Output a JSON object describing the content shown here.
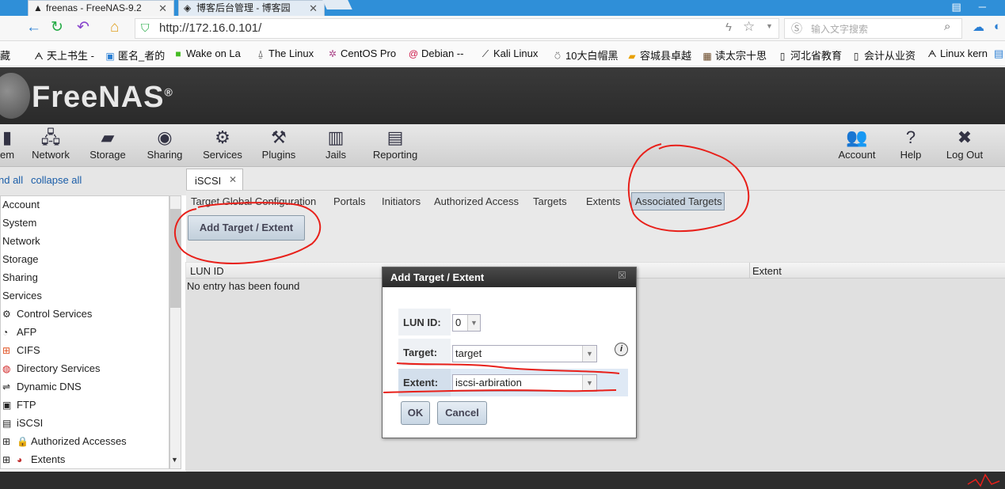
{
  "browser": {
    "tabs": [
      {
        "label": "freenas - FreeNAS-9.2",
        "icon": "freenas-icon"
      },
      {
        "label": "博客后台管理 - 博客园",
        "icon": "page-icon"
      }
    ],
    "url": "http://172.16.0.101/",
    "search_placeholder": "输入文字搜索",
    "bookmarks": [
      {
        "label": "藏",
        "icon": "folder-icon"
      },
      {
        "label": "天上书生 -",
        "icon": "link-icon"
      },
      {
        "label": "匿名_者的",
        "icon": "link-icon"
      },
      {
        "label": "Wake on La",
        "icon": "link-icon"
      },
      {
        "label": "The Linux",
        "icon": "link-icon"
      },
      {
        "label": "CentOS Pro",
        "icon": "link-icon"
      },
      {
        "label": "Debian --",
        "icon": "link-icon"
      },
      {
        "label": "Kali Linux",
        "icon": "link-icon"
      },
      {
        "label": "10大白帽黑",
        "icon": "link-icon"
      },
      {
        "label": "容城县卓越",
        "icon": "link-icon"
      },
      {
        "label": "读太宗十思",
        "icon": "link-icon"
      },
      {
        "label": "河北省教育",
        "icon": "link-icon"
      },
      {
        "label": "会计从业资",
        "icon": "link-icon"
      },
      {
        "label": "Linux kern",
        "icon": "link-icon"
      }
    ]
  },
  "app": {
    "logo": "FreeNAS",
    "logo_mark": "®"
  },
  "toolbar": {
    "items": [
      {
        "label": "em",
        "icon": "system-icon"
      },
      {
        "label": "Network",
        "icon": "network-icon"
      },
      {
        "label": "Storage",
        "icon": "storage-icon"
      },
      {
        "label": "Sharing",
        "icon": "sharing-icon"
      },
      {
        "label": "Services",
        "icon": "services-icon"
      },
      {
        "label": "Plugins",
        "icon": "plugins-icon"
      },
      {
        "label": "Jails",
        "icon": "jails-icon"
      },
      {
        "label": "Reporting",
        "icon": "reporting-icon"
      }
    ],
    "right_items": [
      {
        "label": "Account",
        "icon": "account-icon"
      },
      {
        "label": "Help",
        "icon": "help-icon"
      },
      {
        "label": "Log Out",
        "icon": "logout-icon"
      }
    ]
  },
  "sidebar": {
    "expand_all": "nd all",
    "collapse_all": "collapse all",
    "tree": [
      {
        "label": "Account"
      },
      {
        "label": "System"
      },
      {
        "label": "Network"
      },
      {
        "label": "Storage"
      },
      {
        "label": "Sharing"
      },
      {
        "label": "Services"
      },
      {
        "label": "Control Services",
        "icon": "gears-icon"
      },
      {
        "label": "AFP",
        "icon": "afp-icon"
      },
      {
        "label": "CIFS",
        "icon": "cifs-icon"
      },
      {
        "label": "Directory Services",
        "icon": "directory-icon"
      },
      {
        "label": "Dynamic DNS",
        "icon": "ddns-icon"
      },
      {
        "label": "FTP",
        "icon": "ftp-icon"
      },
      {
        "label": "iSCSI",
        "icon": "iscsi-icon"
      },
      {
        "label": "Authorized Accesses",
        "icon": "lock-icon"
      },
      {
        "label": "Extents",
        "icon": "extents-icon"
      }
    ]
  },
  "main": {
    "active_tab": "iSCSI",
    "subtabs": [
      "Target Global Configuration",
      "Portals",
      "Initiators",
      "Authorized Access",
      "Targets",
      "Extents",
      "Associated Targets"
    ],
    "add_button": "Add Target / Extent",
    "grid": {
      "columns": [
        "LUN ID",
        "Extent"
      ],
      "empty_text": "No entry has been found"
    }
  },
  "dialog": {
    "title": "Add Target / Extent",
    "fields": {
      "lun_label": "LUN ID:",
      "lun_value": "0",
      "target_label": "Target:",
      "target_value": "target",
      "extent_label": "Extent:",
      "extent_value": "iscsi-arbiration"
    },
    "ok": "OK",
    "cancel": "Cancel"
  },
  "colors": {
    "annotation_red": "#e8201a",
    "header_dark": "#2e2e2e",
    "link_blue": "#1a5da8"
  }
}
